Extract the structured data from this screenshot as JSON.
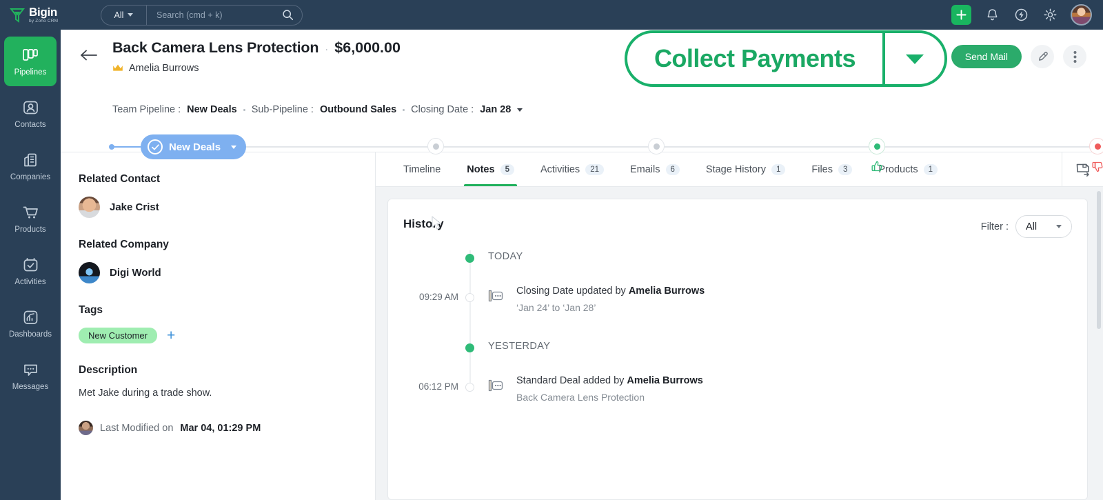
{
  "topnav": {
    "brand_name": "Bigin",
    "brand_sub": "by Zoho CRM",
    "search_scope": "All",
    "search_placeholder": "Search (cmd + k)",
    "search_value": "",
    "icons": [
      "plus-icon",
      "bell-icon",
      "zap-icon",
      "gear-icon",
      "avatar"
    ]
  },
  "sidebar": {
    "items": [
      {
        "label": "Pipelines",
        "icon": "pipelines-icon",
        "active": true
      },
      {
        "label": "Contacts",
        "icon": "contacts-icon",
        "active": false
      },
      {
        "label": "Companies",
        "icon": "companies-icon",
        "active": false
      },
      {
        "label": "Products",
        "icon": "products-icon",
        "active": false
      },
      {
        "label": "Activities",
        "icon": "activities-icon",
        "active": false
      },
      {
        "label": "Dashboards",
        "icon": "dashboards-icon",
        "active": false
      },
      {
        "label": "Messages",
        "icon": "messages-icon",
        "active": false
      }
    ]
  },
  "deal": {
    "title": "Back Camera Lens Protection",
    "separator": "·",
    "amount": "$6,000.00",
    "owner": "Amelia Burrows",
    "meta": {
      "team_pipeline_label": "Team Pipeline :",
      "team_pipeline_value": "New Deals",
      "sub_pipeline_label": "Sub-Pipeline :",
      "sub_pipeline_value": "Outbound Sales",
      "closing_date_label": "Closing Date :",
      "closing_date_value": "Jan 28"
    },
    "actions": {
      "send_mail": "Send Mail",
      "edit_icon": "pencil-icon",
      "more_icon": "more-vertical-icon"
    }
  },
  "stages": {
    "current": "New Deals",
    "nodes": [
      {
        "name": "stage-2",
        "state": "pending"
      },
      {
        "name": "stage-3",
        "state": "pending"
      },
      {
        "name": "stage-won",
        "state": "won",
        "icon": "thumbs-up-icon"
      },
      {
        "name": "stage-lost",
        "state": "lost",
        "icon": "thumbs-down-icon"
      }
    ]
  },
  "left_panel": {
    "related_contact_title": "Related Contact",
    "related_contact_name": "Jake Crist",
    "related_company_title": "Related Company",
    "related_company_name": "Digi World",
    "tags_title": "Tags",
    "tag": "New Customer",
    "add_tag_icon": "plus-icon",
    "description_title": "Description",
    "description_text": "Met Jake during a trade show.",
    "last_modified_label": "Last Modified on",
    "last_modified_value": "Mar 04, 01:29 PM"
  },
  "tabs": [
    {
      "label": "Timeline",
      "count": "",
      "active": false
    },
    {
      "label": "Notes",
      "count": "5",
      "active": true
    },
    {
      "label": "Activities",
      "count": "21",
      "active": false
    },
    {
      "label": "Emails",
      "count": "6",
      "active": false
    },
    {
      "label": "Stage History",
      "count": "1",
      "active": false
    },
    {
      "label": "Files",
      "count": "3",
      "active": false
    },
    {
      "label": "Products",
      "count": "1",
      "active": false
    }
  ],
  "panel_toggle_icon": "collapse-panel-icon",
  "history": {
    "title": "History",
    "filter_label": "Filter :",
    "filter_value": "All",
    "groups": [
      {
        "label": "TODAY",
        "entries": [
          {
            "time": "09:29 AM",
            "icon": "activity-log-icon",
            "text_main": "Closing Date updated by ",
            "text_bold": "Amelia Burrows",
            "text_sub": "‘Jan 24’ to ‘Jan 28’"
          }
        ]
      },
      {
        "label": "YESTERDAY",
        "entries": [
          {
            "time": "06:12 PM",
            "icon": "activity-log-icon",
            "text_main": "Standard Deal added by ",
            "text_bold": "Amelia Burrows",
            "text_sub": "Back Camera Lens Protection"
          }
        ]
      }
    ]
  },
  "callout": {
    "label": "Collect Payments",
    "caret_icon": "chevron-down-icon"
  },
  "colors": {
    "nav_bg": "#2a4057",
    "brand_green": "#22b15d",
    "callout_green": "#19b06a",
    "stage_blue": "#7eb0f0",
    "tag_green": "#9fedb1",
    "won_green": "#2fbb78",
    "lost_red": "#ef5b5b",
    "content_bg": "#f1f3f5"
  }
}
